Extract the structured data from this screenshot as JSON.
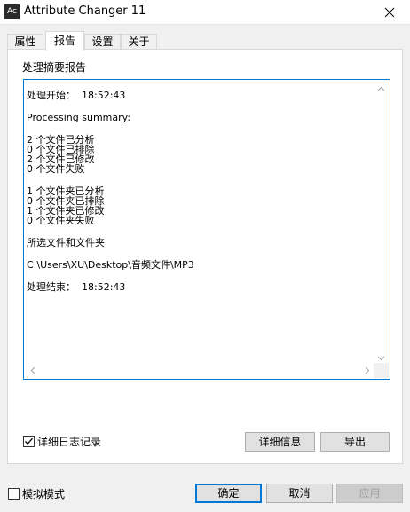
{
  "window": {
    "title": "Attribute Changer 11",
    "app_icon_text": "Ac"
  },
  "tabs": [
    {
      "label": "属性",
      "active": false
    },
    {
      "label": "报告",
      "active": true
    },
    {
      "label": "设置",
      "active": false
    },
    {
      "label": "关于",
      "active": false
    }
  ],
  "panel": {
    "heading": "处理摘要报告",
    "report": {
      "start": "处理开始：  18:52:43",
      "summary_label": "Processing summary:",
      "files": [
        "2 个文件已分析",
        "0 个文件已排除",
        "2 个文件已修改",
        "0 个文件失败"
      ],
      "folders": [
        "1 个文件夹已分析",
        "0 个文件夹已排除",
        "1 个文件夹已修改",
        "0 个文件夹失败"
      ],
      "selection_label": "所选文件和文件夹",
      "path": "C:\\Users\\XU\\Desktop\\音频文件\\MP3",
      "end": "处理结束：  18:52:43"
    },
    "detailed_log": {
      "label": "详细日志记录",
      "checked": true
    },
    "details_button": "详细信息",
    "export_button": "导出"
  },
  "footer": {
    "simulation_mode": {
      "label": "模拟模式",
      "checked": false
    },
    "ok_button": "确定",
    "cancel_button": "取消",
    "apply_button": "应用"
  }
}
